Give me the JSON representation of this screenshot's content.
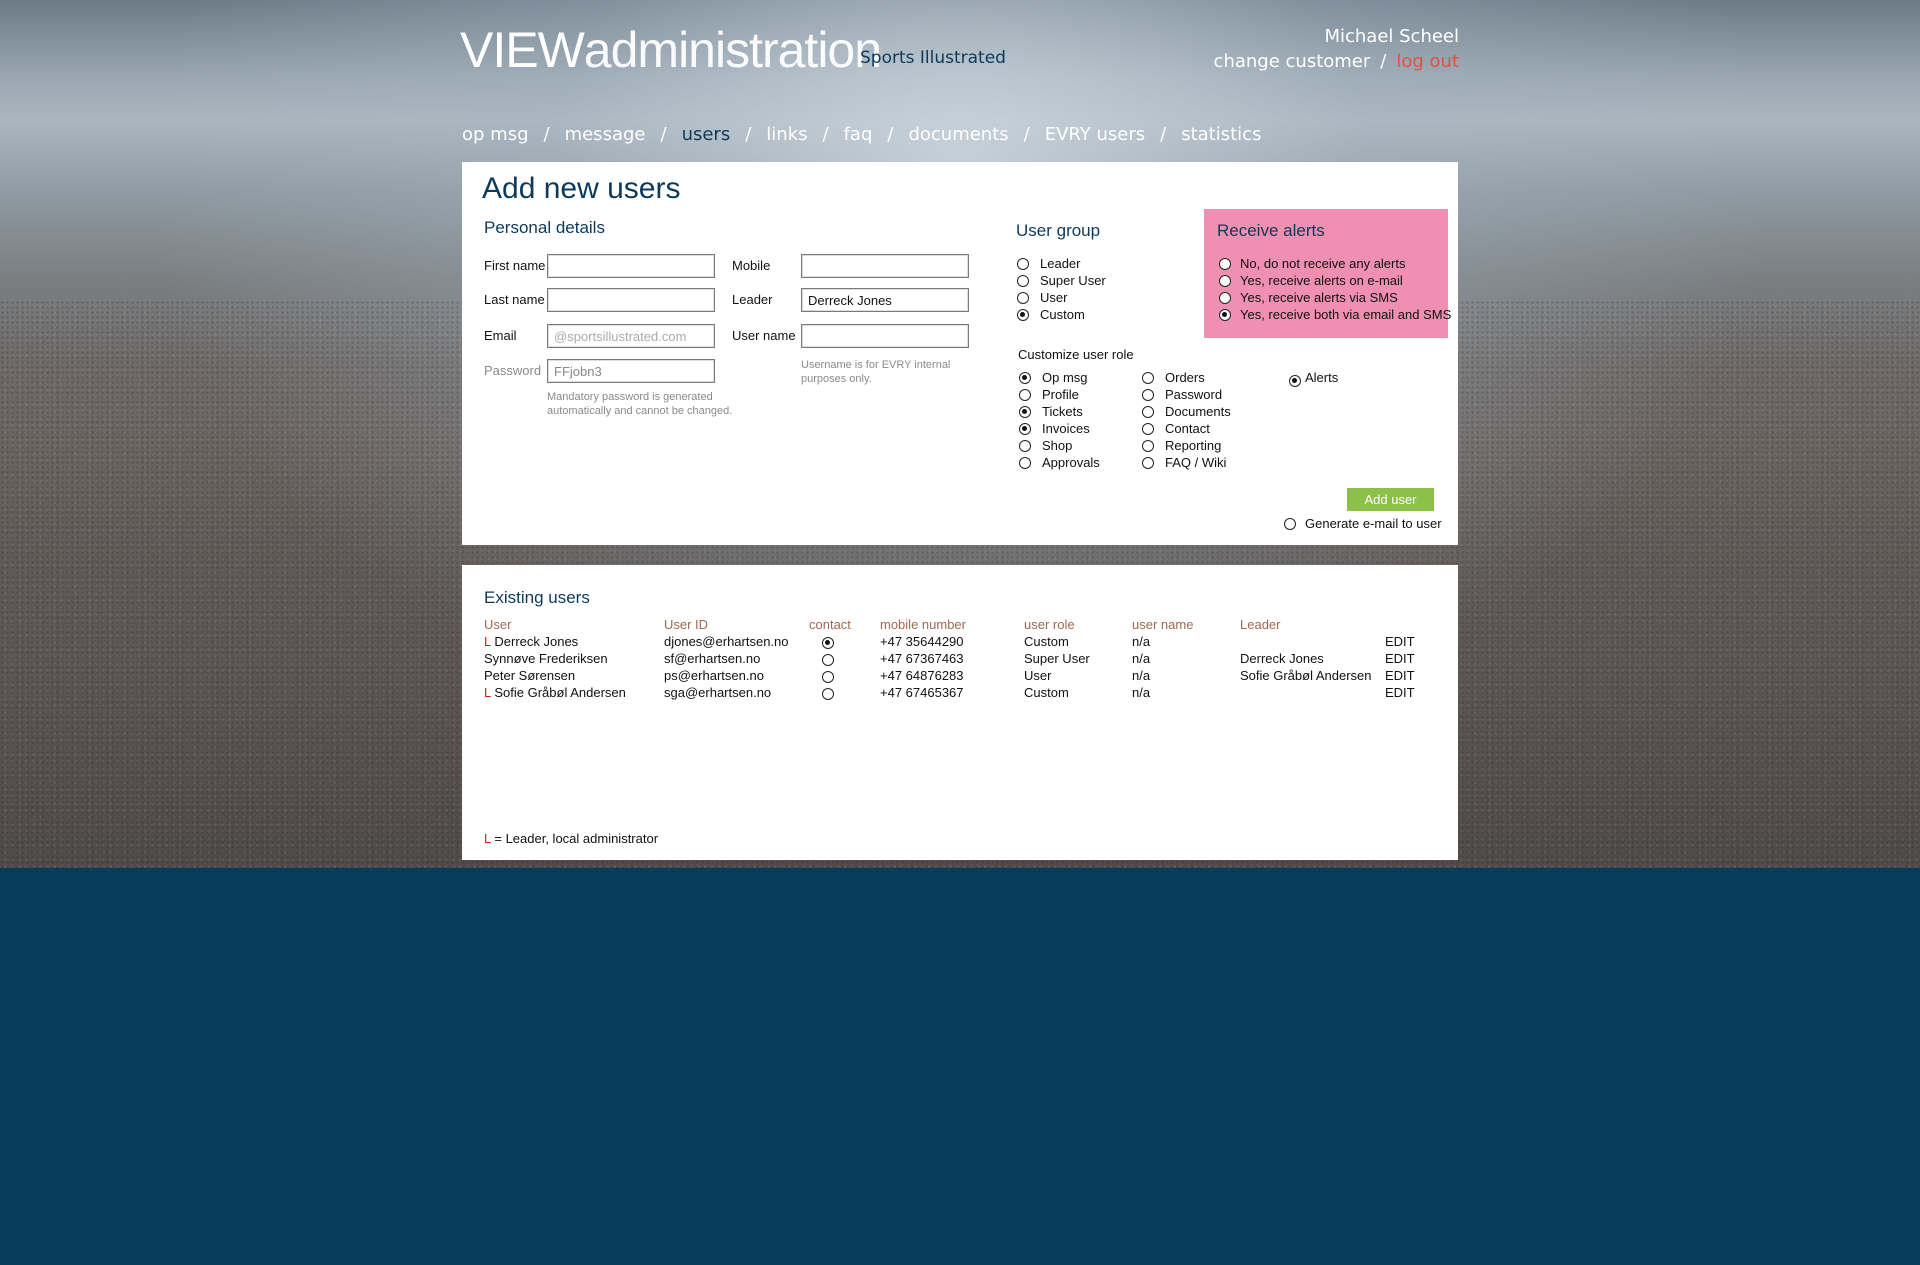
{
  "header": {
    "logo_bold": "VIEW",
    "logo_light": "administration",
    "client_name": "Sports Illustrated",
    "user_name": "Michael Scheel",
    "change_customer": "change customer",
    "separator": "/",
    "logout": "log out"
  },
  "nav": {
    "separator": "/",
    "items": [
      {
        "label": "op msg",
        "active": false
      },
      {
        "label": "message",
        "active": false
      },
      {
        "label": "users",
        "active": true
      },
      {
        "label": "links",
        "active": false
      },
      {
        "label": "faq",
        "active": false
      },
      {
        "label": "documents",
        "active": false
      },
      {
        "label": "EVRY users",
        "active": false
      },
      {
        "label": "statistics",
        "active": false
      }
    ]
  },
  "add_user": {
    "title": "Add new users",
    "personal": {
      "heading": "Personal details",
      "first_name_label": "First name",
      "last_name_label": "Last name",
      "email_label": "Email",
      "email_placeholder": "@sportsillustrated.com",
      "password_label": "Password",
      "password_value": "FFjobn3",
      "password_note": "Mandatory password is generated automatically and cannot be changed.",
      "mobile_label": "Mobile",
      "leader_label": "Leader",
      "leader_value": "Derreck Jones",
      "username_label": "User name",
      "username_note": "Username is for EVRY internal purposes only."
    },
    "user_group": {
      "heading": "User group",
      "options": [
        {
          "label": "Leader",
          "selected": false
        },
        {
          "label": "Super User",
          "selected": false
        },
        {
          "label": "User",
          "selected": false
        },
        {
          "label": "Custom",
          "selected": true
        }
      ]
    },
    "alerts": {
      "heading": "Receive alerts",
      "options": [
        {
          "label": "No, do not receive any alerts",
          "selected": false
        },
        {
          "label": "Yes, receive alerts on e-mail",
          "selected": false
        },
        {
          "label": "Yes, receive alerts via SMS",
          "selected": false
        },
        {
          "label": "Yes, receive both via email and SMS",
          "selected": true
        }
      ]
    },
    "customize": {
      "heading": "Customize user role",
      "col1": [
        {
          "label": "Op msg",
          "selected": true
        },
        {
          "label": "Profile",
          "selected": false
        },
        {
          "label": "Tickets",
          "selected": true
        },
        {
          "label": "Invoices",
          "selected": true
        },
        {
          "label": "Shop",
          "selected": false
        },
        {
          "label": "Approvals",
          "selected": false
        }
      ],
      "col2": [
        {
          "label": "Orders",
          "selected": false
        },
        {
          "label": "Password",
          "selected": false
        },
        {
          "label": "Documents",
          "selected": false
        },
        {
          "label": "Contact",
          "selected": false
        },
        {
          "label": "Reporting",
          "selected": false
        },
        {
          "label": "FAQ / Wiki",
          "selected": false
        }
      ],
      "col3": [
        {
          "label": "Alerts",
          "selected": true
        }
      ]
    },
    "add_button": "Add user",
    "generate_email_label": "Generate e-mail to user",
    "generate_email_selected": false
  },
  "existing": {
    "heading": "Existing users",
    "columns": [
      "User",
      "User ID",
      "contact",
      "mobile number",
      "user role",
      "user name",
      "Leader"
    ],
    "leader_marker": "L",
    "rows": [
      {
        "leader": true,
        "name": "Derreck Jones",
        "user_id": "djones@erhartsen.no",
        "contact": true,
        "mobile": "+47 35644290",
        "role": "Custom",
        "username": "n/a",
        "leader_name": "",
        "action": "EDIT"
      },
      {
        "leader": false,
        "name": "Synnøve Frederiksen",
        "user_id": "sf@erhartsen.no",
        "contact": false,
        "mobile": "+47 67367463",
        "role": "Super User",
        "username": "n/a",
        "leader_name": "Derreck Jones",
        "action": "EDIT"
      },
      {
        "leader": false,
        "name": "Peter Sørensen",
        "user_id": "ps@erhartsen.no",
        "contact": false,
        "mobile": "+47 64876283",
        "role": "User",
        "username": "n/a",
        "leader_name": "Sofie Gråbøl Andersen",
        "action": "EDIT"
      },
      {
        "leader": true,
        "name": "Sofie Gråbøl Andersen",
        "user_id": "sga@erhartsen.no",
        "contact": false,
        "mobile": "+47 67465367",
        "role": "Custom",
        "username": "n/a",
        "leader_name": "",
        "action": "EDIT"
      }
    ],
    "legend_marker": "L",
    "legend_text": " = Leader, local administrator"
  },
  "colors": {
    "brand_navy": "#0d3a5a",
    "page_bottom": "#073c5a",
    "accent_green": "#8cc04a",
    "alerts_pink": "#ef8fb1",
    "logout_red": "#e6503f",
    "leader_red": "#d0201f",
    "column_header_brown": "#a06850"
  }
}
